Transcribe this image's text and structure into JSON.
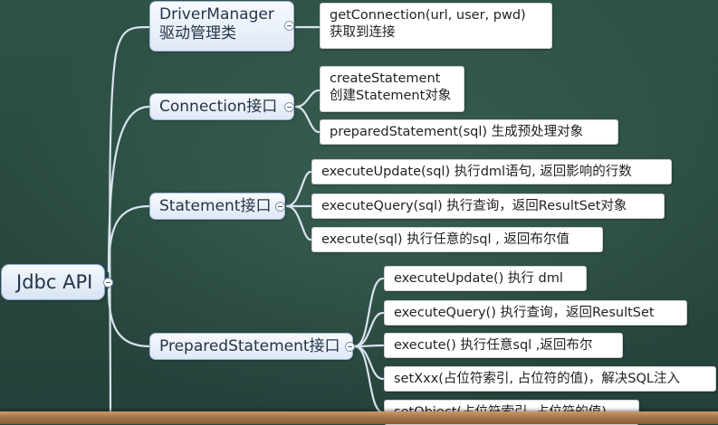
{
  "root": {
    "label": "Jdbc API"
  },
  "categories": [
    {
      "id": "driver-manager",
      "title": "DriverManager",
      "subtitle": "驱动管理类",
      "children": [
        {
          "line1": "getConnection(url, user, pwd)",
          "line2": "获取到连接"
        }
      ]
    },
    {
      "id": "connection",
      "title": "Connection接口",
      "children": [
        {
          "line1": "createStatement",
          "line2": "创建Statement对象"
        },
        {
          "line1": "preparedStatement(sql) 生成预处理对象"
        }
      ]
    },
    {
      "id": "statement",
      "title": "Statement接口",
      "children": [
        {
          "line1": "executeUpdate(sql) 执行dml语句, 返回影响的行数"
        },
        {
          "line1": "executeQuery(sql) 执行查询，返回ResultSet对象"
        },
        {
          "line1": "execute(sql) 执行任意的sql , 返回布尔值"
        }
      ]
    },
    {
      "id": "prepared-statement",
      "title": "PreparedStatement接口",
      "children": [
        {
          "line1": "executeUpdate() 执行 dml"
        },
        {
          "line1": "executeQuery() 执行查询，返回ResultSet"
        },
        {
          "line1": "execute() 执行任意sql ,返回布尔"
        },
        {
          "line1": "setXxx(占位符索引, 占位符的值)，解决SQL注入"
        },
        {
          "line1": "setObject(占位符索引, 占位符的值)"
        }
      ]
    }
  ],
  "colors": {
    "board": "#2a4a40",
    "connector": "#d8e3ee",
    "node_border": "#9eb4d6",
    "frame": "#a8774a"
  }
}
